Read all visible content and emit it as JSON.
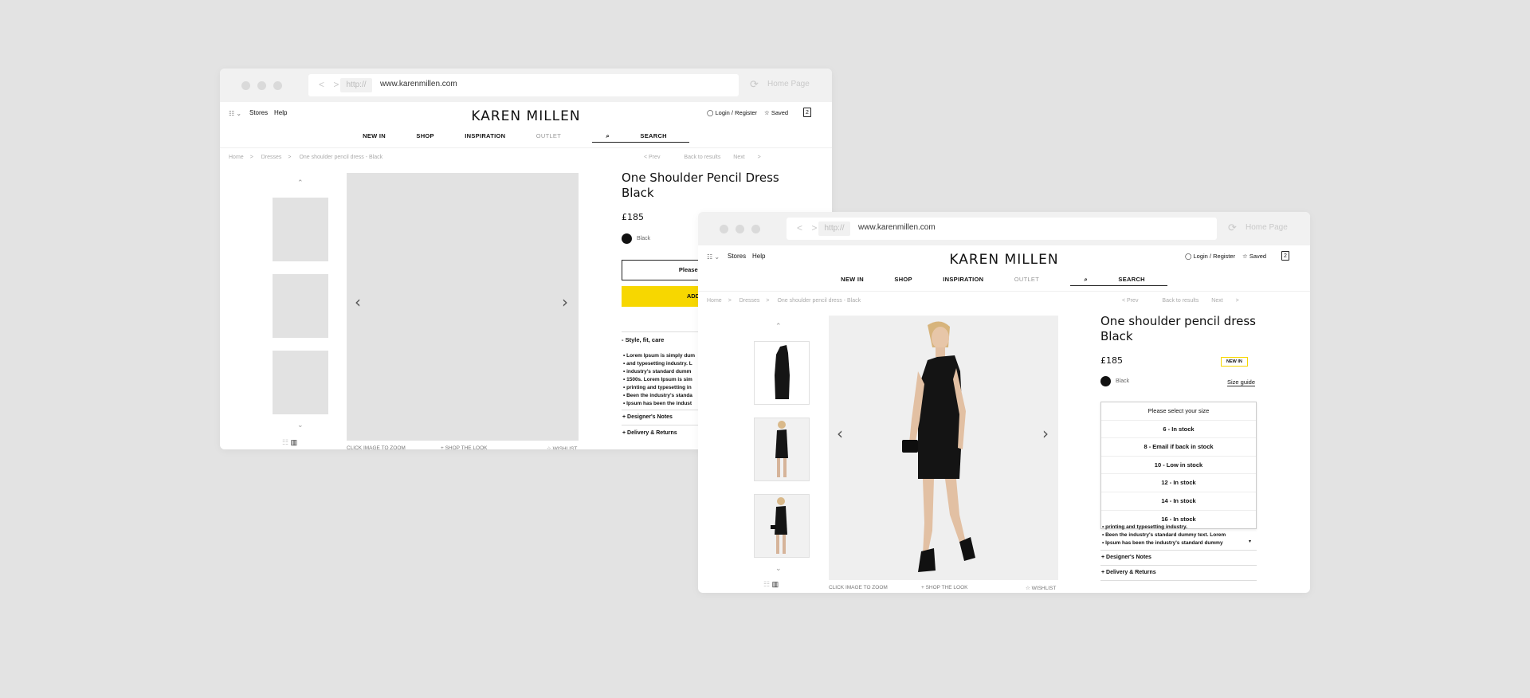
{
  "browser": {
    "nav_arrows": "< >",
    "protocol": "http://",
    "address": "www.karenmillen.com",
    "home_label": "Home Page"
  },
  "header": {
    "stores": "Stores",
    "help": "Help",
    "brand": "KAREN MILLEN",
    "login": "Login / Register",
    "saved": "Saved",
    "bag_count": "2"
  },
  "nav": {
    "new_in": "NEW IN",
    "shop": "SHOP",
    "inspiration": "INSPIRATION",
    "outlet": "OUTLET",
    "search": "SEARCH"
  },
  "breadcrumb": {
    "home": "Home",
    "dresses": "Dresses",
    "current": "One shoulder pencil dress - Black"
  },
  "pager": {
    "prev": "Prev",
    "back": "Back to results",
    "next": "Next"
  },
  "media": {
    "zoom": "CLICK IMAGE TO ZOOM",
    "shop_look": "+ SHOP THE LOOK",
    "wishlist": "WISHLIST"
  },
  "product_wireframe": {
    "title": "One Shoulder Pencil Dress Black",
    "price": "£185",
    "color": "Black",
    "size_select": "Please sel",
    "add": "ADD",
    "style_heading": "- Style, fit, care",
    "bullets": [
      "Lorem Ipsum is simply dum",
      "and typesetting industry. L",
      "industry's standard dumm",
      "1500s. Lorem Ipsum is sim",
      "printing and typesetting in",
      "Been the industry's standa",
      "Ipsum has been the indust"
    ],
    "designers_notes": "+ Designer's Notes",
    "delivery": "+ Delivery & Returns"
  },
  "product": {
    "title": "One shoulder pencil dress Black",
    "price": "£185",
    "badge": "NEW IN",
    "color": "Black",
    "size_guide": "Size guide",
    "size_options": [
      "Please select your size",
      "6 - In stock",
      "8 - Email if back in stock",
      "10 - Low in stock",
      "12 - In stock",
      "14 - In stock",
      "16 - In stock"
    ],
    "bullets": [
      "printing and typesetting industry.",
      "Been the industry's standard dummy text. Lorem",
      "Ipsum has been the industry's standard dummy"
    ],
    "designers_notes": "+ Designer's Notes",
    "delivery": "+ Delivery & Returns"
  },
  "colors": {
    "accent": "#f7d700",
    "background": "#e3e3e3",
    "placeholder": "#e2e2e2"
  }
}
